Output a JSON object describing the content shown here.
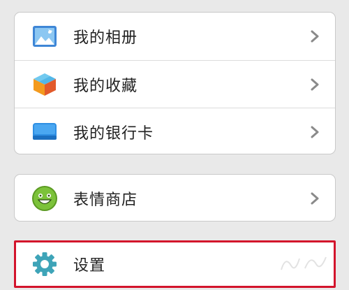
{
  "menu": {
    "groups": [
      {
        "items": [
          {
            "label": "我的相册",
            "icon": "photo-album-icon"
          },
          {
            "label": "我的收藏",
            "icon": "favorites-box-icon"
          },
          {
            "label": "我的银行卡",
            "icon": "bank-card-icon"
          }
        ]
      },
      {
        "items": [
          {
            "label": "表情商店",
            "icon": "emoji-smile-icon"
          }
        ]
      },
      {
        "items": [
          {
            "label": "设置",
            "icon": "gear-icon",
            "highlighted": true
          }
        ]
      }
    ]
  },
  "colors": {
    "background": "#e9e9e9",
    "highlight_border": "#d3142c",
    "album_blue": "#3e86d6",
    "card_blue": "#2f8fe3",
    "emoji_green": "#7cc23a",
    "gear_teal": "#3ea4b8"
  }
}
